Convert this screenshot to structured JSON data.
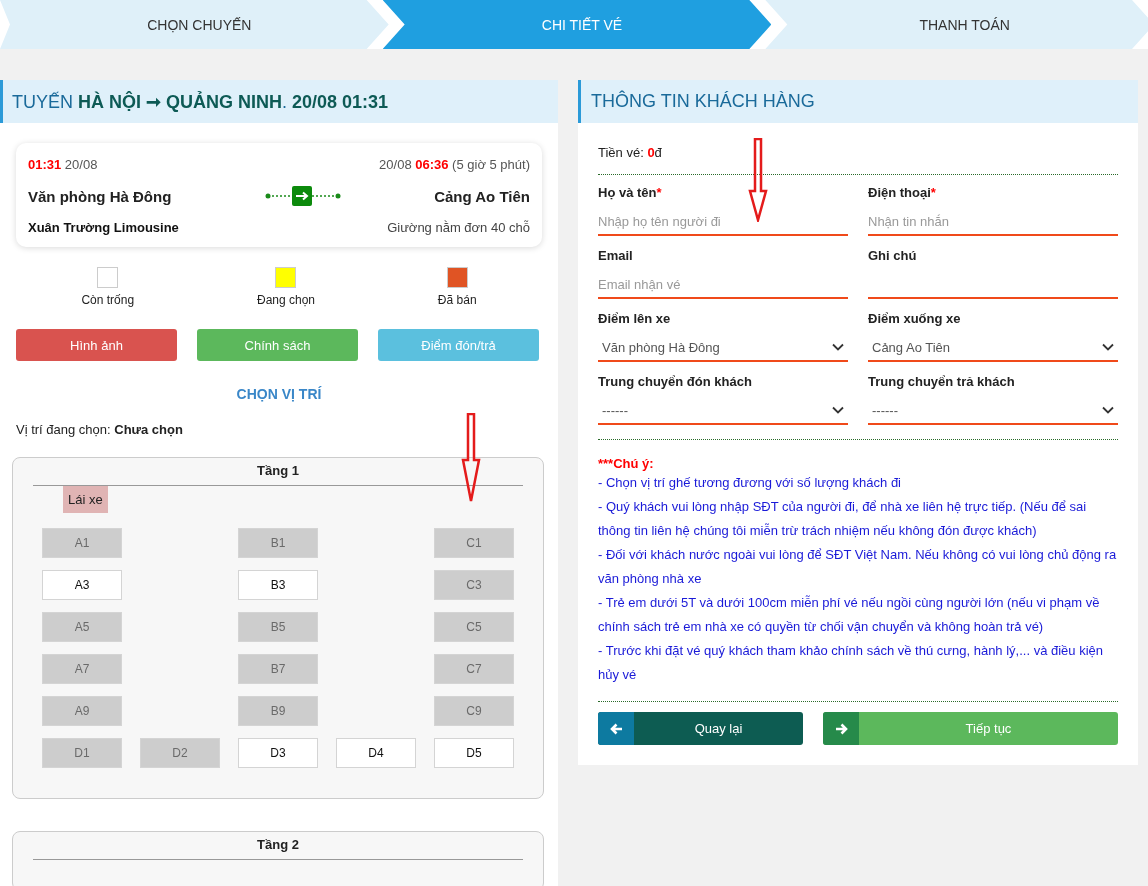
{
  "steps": [
    {
      "label": "CHỌN CHUYẾN",
      "selected": false
    },
    {
      "label": "CHI TIẾT VÉ",
      "selected": true
    },
    {
      "label": "THANH TOÁN",
      "selected": false
    }
  ],
  "route_panel": {
    "title": "TUYẾN **HÀ NỘI ➞ QUẢNG NINH**. **20/08 01:31**",
    "trip": {
      "depart_time": "01:31",
      "depart_date": "20/08",
      "arrive_date": "20/08",
      "arrive_time": "06:36",
      "duration": "(5 giờ 5 phút)",
      "origin": "Văn phòng Hà Đông",
      "destination": "Cảng Ao Tiên",
      "operator": "Xuân Trường Limousine",
      "vehicle": "Giường nằm đơn 40 chỗ"
    },
    "legend": [
      {
        "label": "Còn trống",
        "color": "#ffffff"
      },
      {
        "label": "Đang chọn",
        "color": "#ffff00"
      },
      {
        "label": "Đã bán",
        "color": "#e05424"
      }
    ],
    "buttons": [
      {
        "label": "Hình ảnh",
        "color": "#d9534f"
      },
      {
        "label": "Chính sách",
        "color": "#5cb85c"
      },
      {
        "label": "Điểm đón/trả",
        "color": "#5bc0de"
      }
    ],
    "seat_heading": "CHỌN VỊ TRÍ",
    "selected_label": "Vị trí đang chọn:",
    "selected_value": "Chưa chọn",
    "floors": [
      {
        "title": "Tầng 1",
        "driver": "Lái xe",
        "rows": [
          [
            {
              "kind": "seat",
              "label": "A1",
              "available": false
            },
            {
              "kind": "gap"
            },
            {
              "kind": "seat",
              "label": "B1",
              "available": false
            },
            {
              "kind": "gap"
            },
            {
              "kind": "seat",
              "label": "C1",
              "available": false
            }
          ],
          [
            {
              "kind": "seat",
              "label": "A3",
              "available": true
            },
            {
              "kind": "gap"
            },
            {
              "kind": "seat",
              "label": "B3",
              "available": true
            },
            {
              "kind": "gap"
            },
            {
              "kind": "seat",
              "label": "C3",
              "available": false
            }
          ],
          [
            {
              "kind": "seat",
              "label": "A5",
              "available": false
            },
            {
              "kind": "gap"
            },
            {
              "kind": "seat",
              "label": "B5",
              "available": false
            },
            {
              "kind": "gap"
            },
            {
              "kind": "seat",
              "label": "C5",
              "available": false
            }
          ],
          [
            {
              "kind": "seat",
              "label": "A7",
              "available": false
            },
            {
              "kind": "gap"
            },
            {
              "kind": "seat",
              "label": "B7",
              "available": false
            },
            {
              "kind": "gap"
            },
            {
              "kind": "seat",
              "label": "C7",
              "available": false
            }
          ],
          [
            {
              "kind": "seat",
              "label": "A9",
              "available": false
            },
            {
              "kind": "gap"
            },
            {
              "kind": "seat",
              "label": "B9",
              "available": false
            },
            {
              "kind": "gap"
            },
            {
              "kind": "seat",
              "label": "C9",
              "available": false
            }
          ],
          [
            {
              "kind": "seat",
              "label": "D1",
              "available": false
            },
            {
              "kind": "seat",
              "label": "D2",
              "available": false
            },
            {
              "kind": "seat",
              "label": "D3",
              "available": true
            },
            {
              "kind": "seat",
              "label": "D4",
              "available": true
            },
            {
              "kind": "seat",
              "label": "D5",
              "available": true
            }
          ]
        ]
      },
      {
        "title": "Tầng 2"
      }
    ]
  },
  "customer_panel": {
    "title": "THÔNG TIN KHÁCH HÀNG",
    "price_label": "Tiền vé:",
    "price_amount": "0",
    "price_unit": "đ",
    "fields": [
      {
        "kind": "text",
        "label": "Họ và tên",
        "required_mark": "*",
        "placeholder": "Nhập họ tên người đi"
      },
      {
        "kind": "text",
        "label": "Điện thoại",
        "required_mark": "*",
        "placeholder": "Nhận tin nhắn"
      },
      {
        "kind": "text",
        "label": "Email",
        "placeholder": "Email nhận vé"
      },
      {
        "kind": "text",
        "label": "Ghi chú"
      },
      {
        "kind": "select",
        "label": "Điểm lên xe",
        "value": "Văn phòng Hà Đông"
      },
      {
        "kind": "select",
        "label": "Điểm xuống xe",
        "value": "Cảng Ao Tiên"
      },
      {
        "kind": "select",
        "label": "Trung chuyển đón khách",
        "value": "------"
      },
      {
        "kind": "select",
        "label": "Trung chuyển trả khách",
        "value": "------"
      }
    ],
    "notice_title": "***Chú ý:",
    "notices": [
      "- Chọn vị trí ghế tương đương với số lượng khách đi",
      "- Quý khách vui lòng nhập SĐT của người đi, để nhà xe liên hệ trực tiếp. (Nếu để sai thông tin liên hệ chúng tôi miễn trừ trách nhiệm nếu không đón được khách)",
      "- Đối với khách nước ngoài vui lòng để SĐT Việt Nam. Nếu không có vui lòng chủ động ra văn phòng nhà xe",
      "- Trẻ em dưới 5T và dưới 100cm miễn phí vé nếu ngồi cùng người lớn (nếu vi phạm về chính sách trẻ em nhà xe có quyền từ chối vận chuyển và không hoàn trả vé)",
      "- Trước khi đặt vé quý khách tham khảo chính sách về thú cưng, hành lý,... và điều kiện hủy vé"
    ],
    "actions": [
      {
        "kind": "back",
        "label": "Quay lại"
      },
      {
        "kind": "next",
        "label": "Tiếp tục"
      }
    ]
  }
}
